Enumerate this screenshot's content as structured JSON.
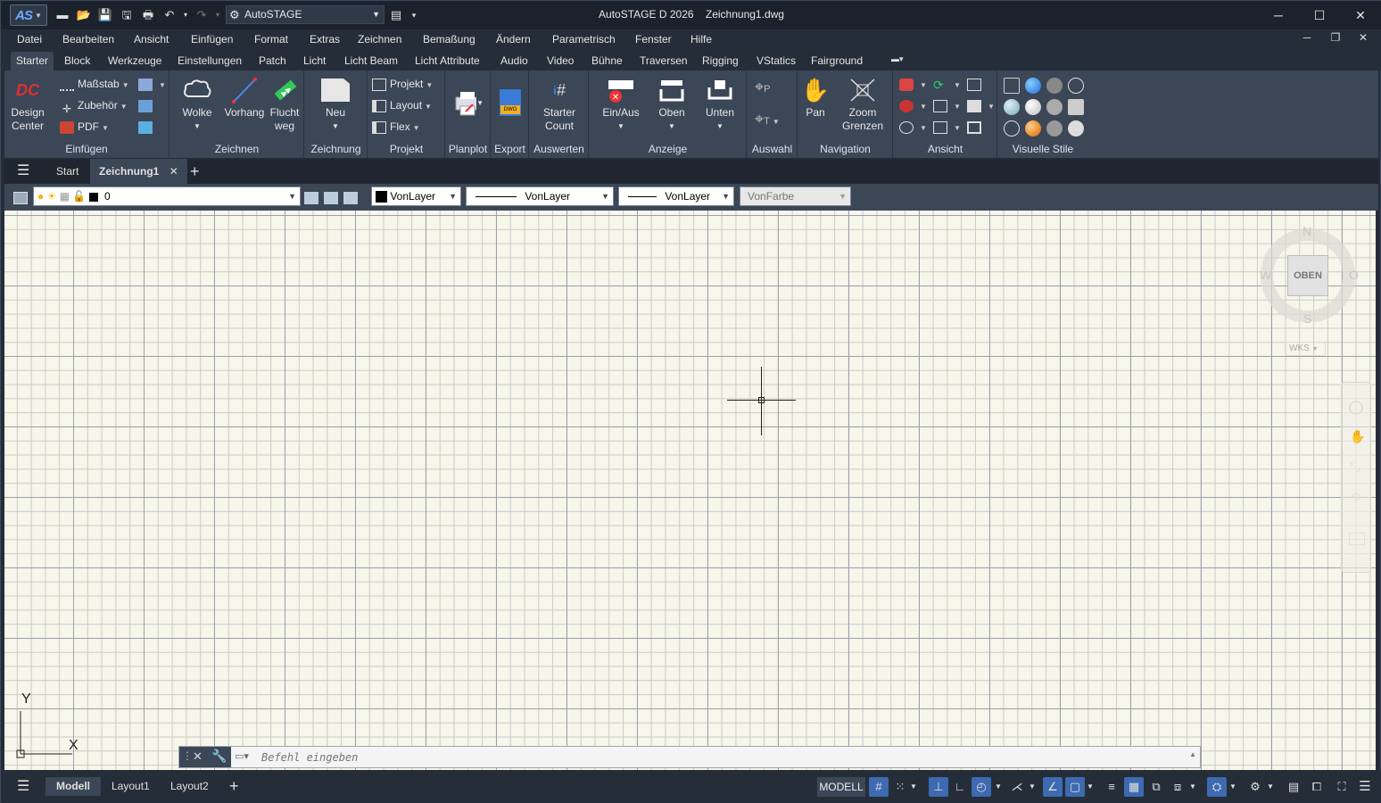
{
  "app": {
    "workspace": "AutoSTAGE",
    "title_app": "AutoSTAGE D 2026",
    "title_file": "Zeichnung1.dwg"
  },
  "menubar": [
    "Datei",
    "Bearbeiten",
    "Ansicht",
    "Einfügen",
    "Format",
    "Extras",
    "Zeichnen",
    "Bemaßung",
    "Ändern",
    "Parametrisch",
    "Fenster",
    "Hilfe"
  ],
  "ribbon_tabs": [
    "Starter",
    "Block",
    "Werkzeuge",
    "Einstellungen",
    "Patch",
    "Licht",
    "Licht Beam",
    "Licht Attribute",
    "Audio",
    "Video",
    "Bühne",
    "Traversen",
    "Rigging",
    "VStatics",
    "Fairground"
  ],
  "ribbon": {
    "einfuegen": {
      "title": "Einfügen",
      "design_center": "Design\nCenter",
      "massstab": "Maßstab",
      "zubehoer": "Zubehör",
      "pdf": "PDF"
    },
    "zeichnen": {
      "title": "Zeichnen",
      "wolke": "Wolke",
      "vorhang": "Vorhang",
      "fluchtweg": "Flucht\nweg"
    },
    "zeichnung": {
      "title": "Zeichnung",
      "neu": "Neu"
    },
    "projekt": {
      "title": "Projekt",
      "projekt": "Projekt",
      "layout": "Layout",
      "flex": "Flex"
    },
    "planplot": {
      "title": "Planplot"
    },
    "export": {
      "title": "Export"
    },
    "auswerten": {
      "title": "Auswerten",
      "starter_count": "Starter\nCount"
    },
    "anzeige": {
      "title": "Anzeige",
      "einaus": "Ein/Aus",
      "oben": "Oben",
      "unten": "Unten"
    },
    "auswahl": {
      "title": "Auswahl"
    },
    "navigation": {
      "title": "Navigation",
      "pan": "Pan",
      "zoom": "Zoom\nGrenzen"
    },
    "ansicht": {
      "title": "Ansicht"
    },
    "visuelle": {
      "title": "Visuelle Stile"
    }
  },
  "filetabs": {
    "start": "Start",
    "active": "Zeichnung1"
  },
  "layerbar": {
    "layer": "0",
    "color": "VonLayer",
    "linetype": "VonLayer",
    "lineweight": "VonLayer",
    "plotstyle": "VonFarbe"
  },
  "canvas": {
    "viewcube": {
      "face": "OBEN",
      "n": "N",
      "s": "S",
      "w": "W",
      "e": "O",
      "wcs": "WKS"
    },
    "ucs": {
      "x": "X",
      "y": "Y"
    }
  },
  "command": {
    "placeholder": "Befehl eingeben"
  },
  "statusbar": {
    "model_tab": "Modell",
    "layout1": "Layout1",
    "layout2": "Layout2",
    "space": "MODELL"
  }
}
